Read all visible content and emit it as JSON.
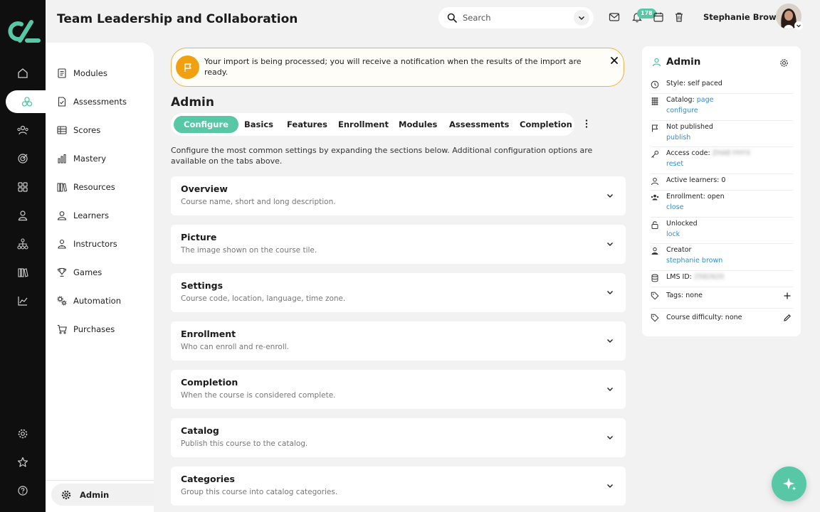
{
  "app": {
    "title": "Team Leadership and Collaboration",
    "accent_color": "#57c7a6",
    "alert_color": "#f0a010",
    "link_color": "#2b8fd6"
  },
  "rail": {
    "logo": "app-logo",
    "items": [
      "home-icon",
      "modules-icon",
      "users-icon",
      "target-icon",
      "grid-icon",
      "person-icon",
      "hierarchy-icon",
      "library-icon",
      "chart-icon"
    ],
    "bottom_items": [
      "gear-icon",
      "star-icon",
      "help-icon"
    ]
  },
  "sidebar": {
    "items": [
      {
        "label": "Modules",
        "icon": "document-list-icon"
      },
      {
        "label": "Assessments",
        "icon": "assessment-icon"
      },
      {
        "label": "Scores",
        "icon": "table-icon"
      },
      {
        "label": "Mastery",
        "icon": "bar-chart-icon"
      },
      {
        "label": "Resources",
        "icon": "books-icon"
      },
      {
        "label": "Learners",
        "icon": "person-icon"
      },
      {
        "label": "Instructors",
        "icon": "instructor-icon"
      },
      {
        "label": "Games",
        "icon": "trophy-icon"
      },
      {
        "label": "Automation",
        "icon": "gears-icon"
      },
      {
        "label": "Purchases",
        "icon": "cart-icon"
      }
    ],
    "admin_label": "Admin"
  },
  "header": {
    "search_placeholder": "Search",
    "notification_count": "178",
    "user_name": "Stephanie Brown"
  },
  "alert": {
    "message": "Your import is being processed; you will receive a notification when the results of the import are ready."
  },
  "main": {
    "section_title": "Admin",
    "tabs": [
      "Configure",
      "Basics",
      "Features",
      "Enrollment",
      "Modules",
      "Assessments",
      "Completion"
    ],
    "active_tab": "Configure",
    "intro": "Configure the most common settings by expanding the sections below. Additional configuration options are available on the tabs above.",
    "cards": [
      {
        "title": "Overview",
        "desc": "Course name, short and long description."
      },
      {
        "title": "Picture",
        "desc": "The image shown on the course tile."
      },
      {
        "title": "Settings",
        "desc": "Course code, location, language, time zone."
      },
      {
        "title": "Enrollment",
        "desc": "Who can enroll and re-enroll."
      },
      {
        "title": "Completion",
        "desc": "When the course is considered complete."
      },
      {
        "title": "Catalog",
        "desc": "Publish this course to the catalog."
      },
      {
        "title": "Categories",
        "desc": "Group this course into catalog categories."
      }
    ]
  },
  "admin_panel": {
    "title": "Admin",
    "style": "Style: self paced",
    "catalog_label": "Catalog: ",
    "catalog_link": "page",
    "catalog_action": "configure",
    "publish_status": "Not published",
    "publish_action": "publish",
    "access_code_label": "Access code: ",
    "access_code_value": "ZHAE-YHYX",
    "access_code_action": "reset",
    "active_learners": "Active learners: 0",
    "enrollment_status": "Enrollment: open",
    "enrollment_action": "close",
    "lock_status": "Unlocked",
    "lock_action": "lock",
    "creator_label": "Creator",
    "creator_name": "stephanie brown",
    "lms_id_label": "LMS ID: ",
    "lms_id_value": "2582620",
    "tags": "Tags: none",
    "difficulty": "Course difficulty: none"
  }
}
